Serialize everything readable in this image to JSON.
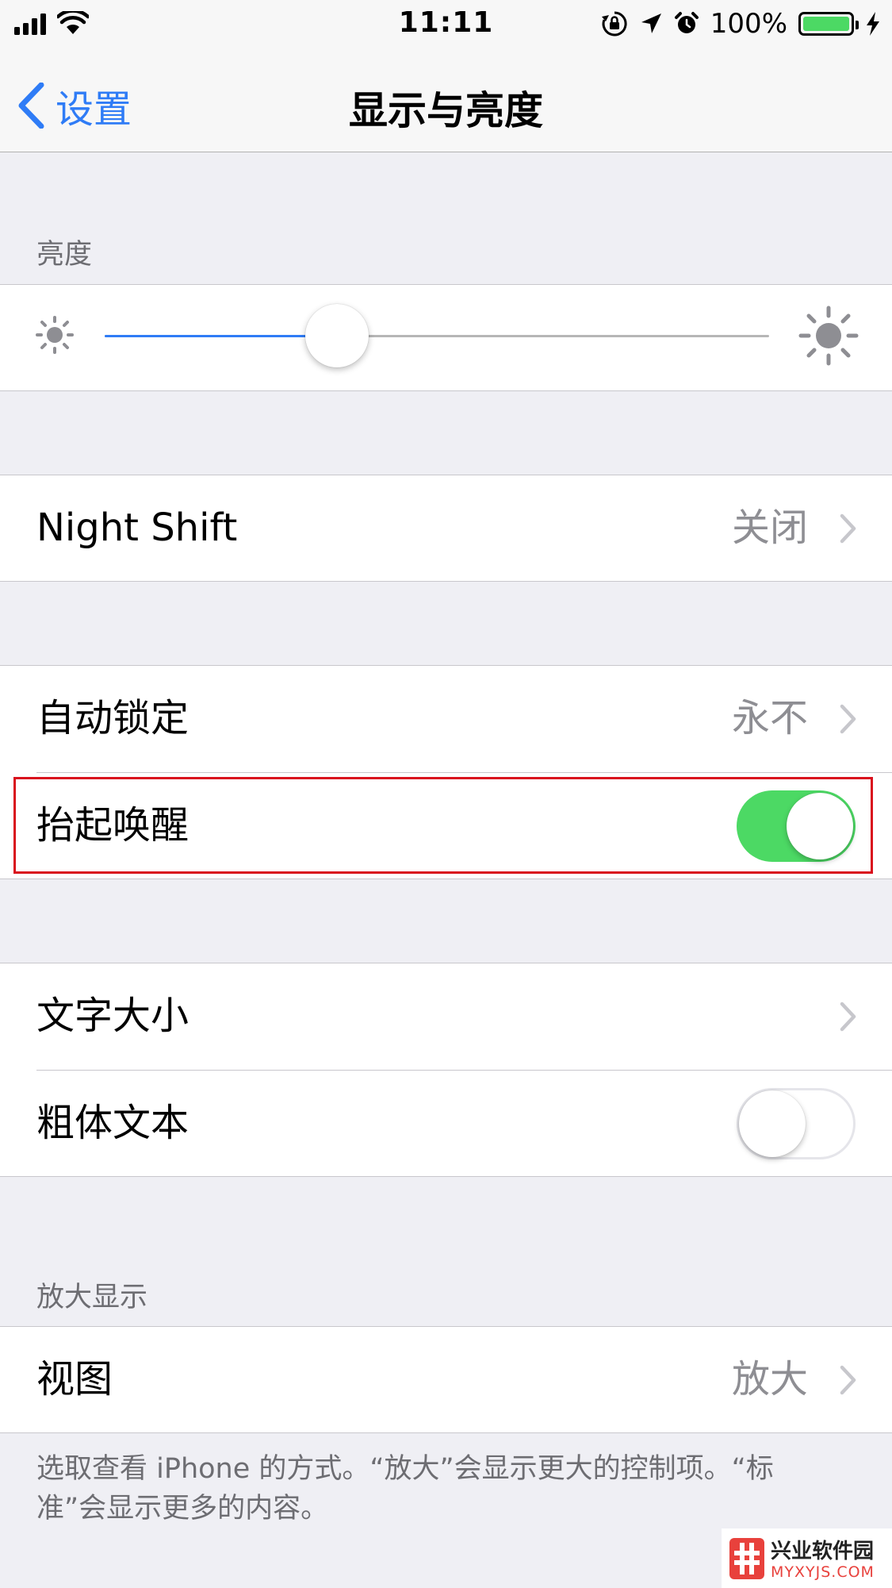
{
  "status_bar": {
    "time": "11:11",
    "battery_percent": "100%",
    "battery_level": 1.0,
    "battery_color": "#4cd964",
    "icons": [
      "signal-icon",
      "wifi-icon",
      "orientation-lock-icon",
      "location-icon",
      "alarm-icon",
      "battery-icon",
      "charging-icon"
    ]
  },
  "nav": {
    "back_label": "设置",
    "title": "显示与亮度",
    "accent_color": "#2f7cf6"
  },
  "brightness": {
    "header": "亮度",
    "level": 0.35
  },
  "night_shift": {
    "label": "Night Shift",
    "value": "关闭"
  },
  "auto_lock": {
    "label": "自动锁定",
    "value": "永不"
  },
  "raise_to_wake": {
    "label": "抬起唤醒",
    "enabled": true,
    "highlighted": true
  },
  "text_size": {
    "label": "文字大小"
  },
  "bold_text": {
    "label": "粗体文本",
    "enabled": false
  },
  "display_zoom": {
    "header": "放大显示",
    "view_label": "视图",
    "view_value": "放大",
    "footer": "选取查看 iPhone 的方式。“放大”会显示更大的控制项。“标准”会显示更多的内容。"
  },
  "watermark": {
    "title": "兴业软件园",
    "url": "MYXYJS.COM"
  }
}
